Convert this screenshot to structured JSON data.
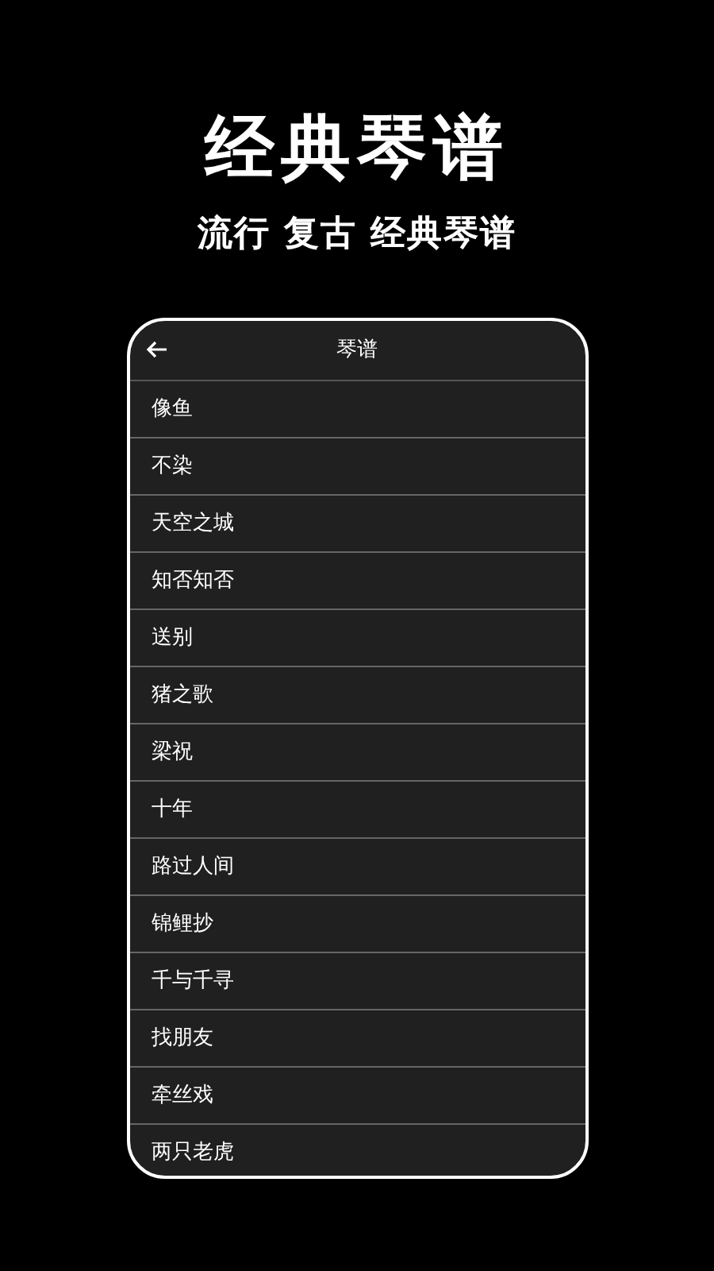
{
  "headline": "经典琴谱",
  "subheadline": "流行 复古 经典琴谱",
  "screen": {
    "title": "琴谱",
    "items": [
      "像鱼",
      "不染",
      "天空之城",
      "知否知否",
      "送别",
      "猪之歌",
      "梁祝",
      "十年",
      "路过人间",
      "锦鲤抄",
      "千与千寻",
      "找朋友",
      "牵丝戏",
      "两只老虎"
    ]
  }
}
